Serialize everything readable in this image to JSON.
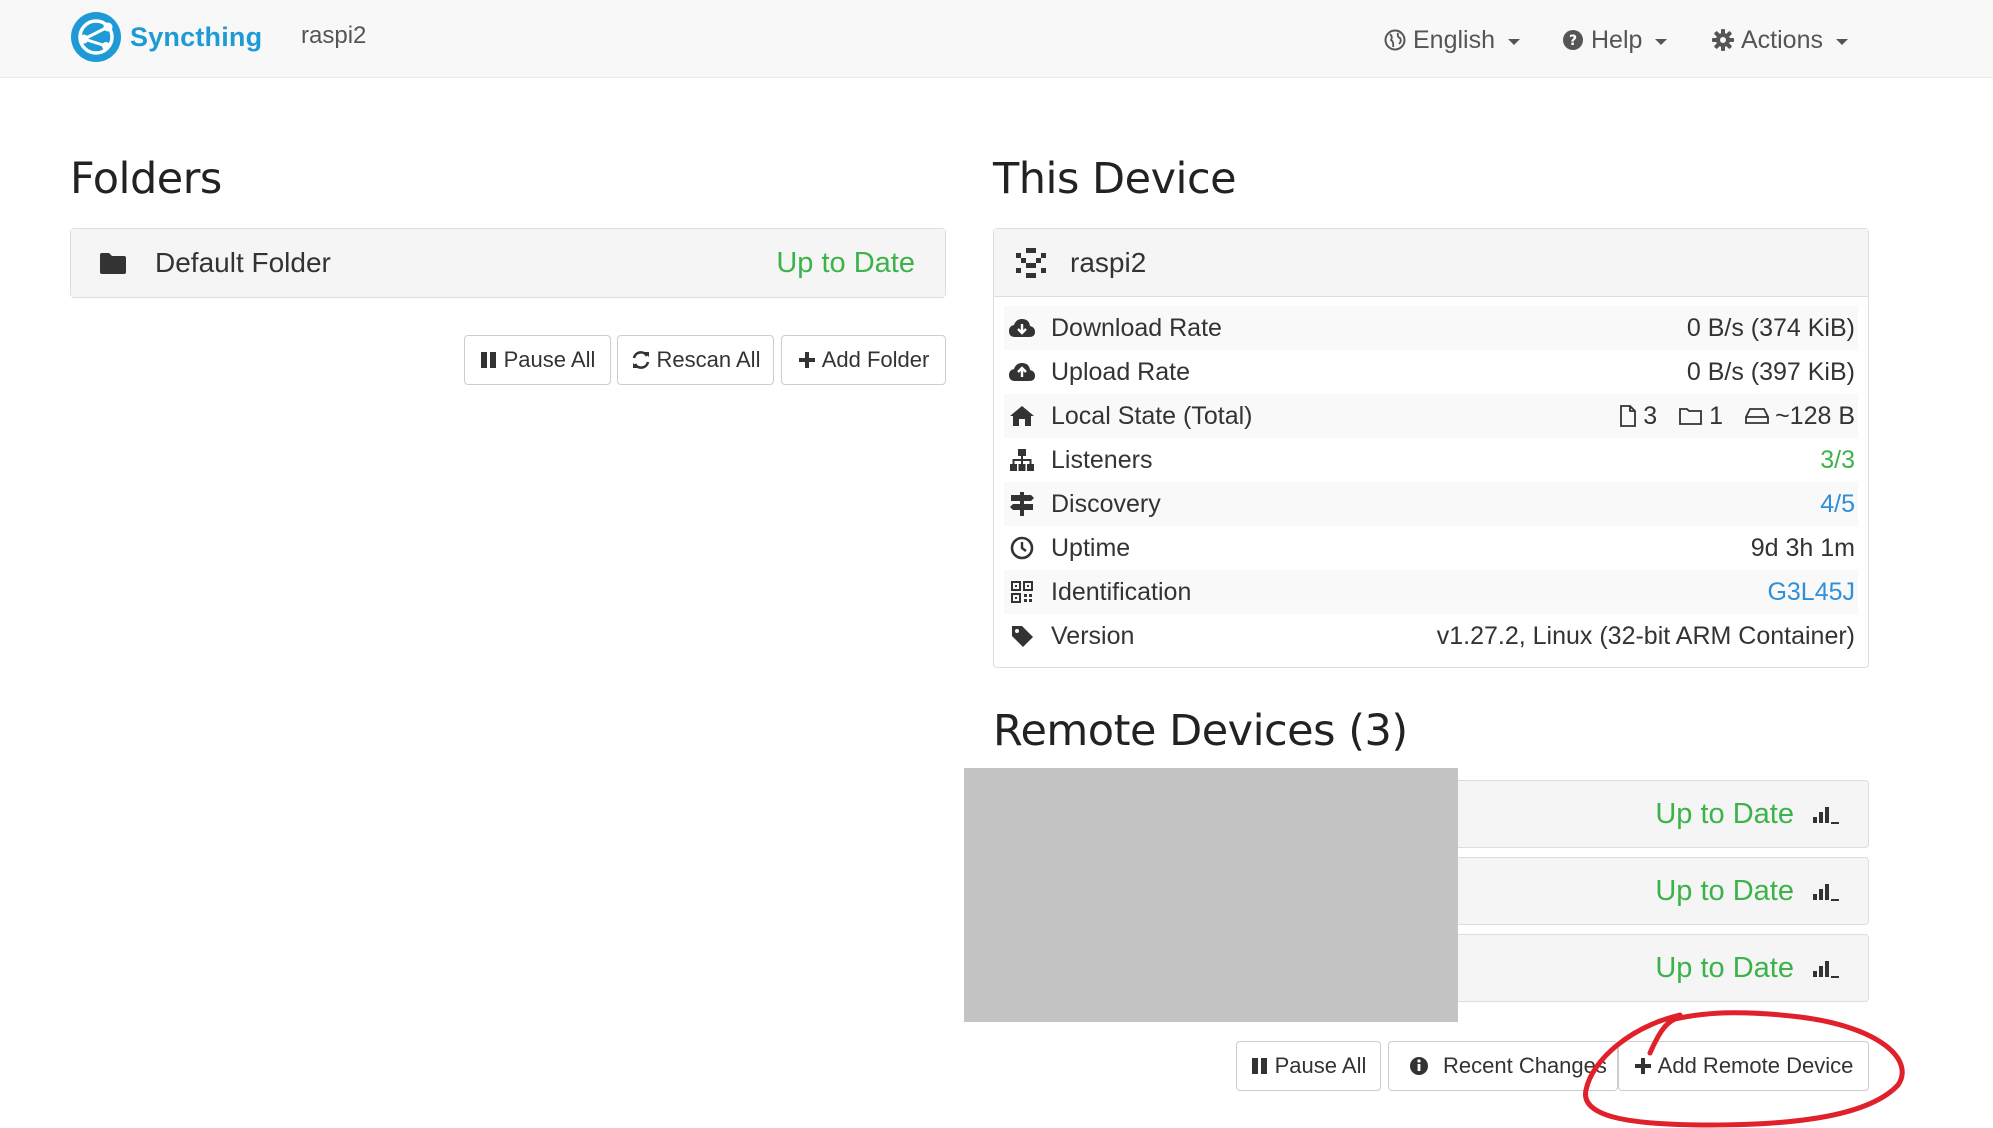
{
  "navbar": {
    "brand": "Syncthing",
    "device_name": "raspi2",
    "language": "English",
    "help": "Help",
    "actions": "Actions"
  },
  "folders": {
    "title": "Folders",
    "items": [
      {
        "name": "Default Folder",
        "status": "Up to Date"
      }
    ],
    "buttons": {
      "pause_all": "Pause All",
      "rescan_all": "Rescan All",
      "add_folder": "Add Folder"
    }
  },
  "this_device": {
    "title": "This Device",
    "name": "raspi2",
    "stats": {
      "download_rate": {
        "label": "Download Rate",
        "value": "0 B/s (374 KiB)"
      },
      "upload_rate": {
        "label": "Upload Rate",
        "value": "0 B/s (397 KiB)"
      },
      "local_state": {
        "label": "Local State (Total)",
        "files": "3",
        "dirs": "1",
        "size": "~128 B"
      },
      "listeners": {
        "label": "Listeners",
        "value": "3/3"
      },
      "discovery": {
        "label": "Discovery",
        "value": "4/5"
      },
      "uptime": {
        "label": "Uptime",
        "value": "9d 3h 1m"
      },
      "identification": {
        "label": "Identification",
        "value": "G3L45J"
      },
      "version": {
        "label": "Version",
        "value": "v1.27.2, Linux (32-bit ARM Container)"
      }
    }
  },
  "remote_devices": {
    "title": "Remote Devices (3)",
    "items": [
      {
        "status": "Up to Date"
      },
      {
        "status": "Up to Date"
      },
      {
        "status": "Up to Date"
      }
    ],
    "buttons": {
      "pause_all": "Pause All",
      "recent_changes": "Recent Changes",
      "add_remote_device": "Add Remote Device"
    }
  },
  "colors": {
    "brand": "#1e9bd6",
    "status_ok": "#3cb34a",
    "link": "#2f8fd8",
    "annotation": "#e0202a",
    "redaction": "#c4c4c4"
  }
}
